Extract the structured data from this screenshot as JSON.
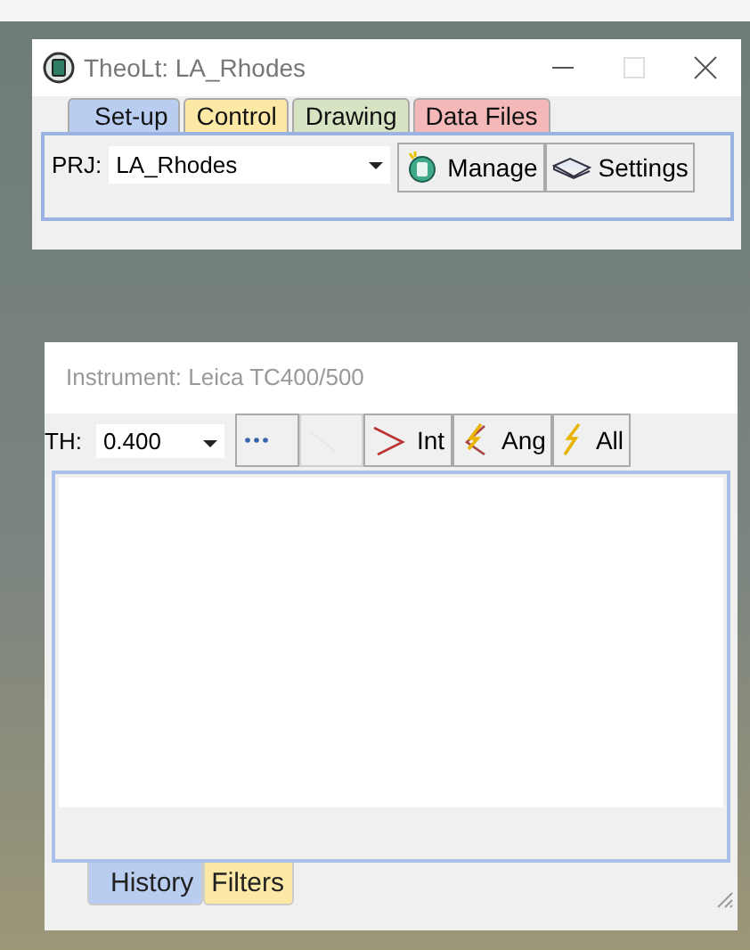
{
  "main_window": {
    "title": "TheoLt: LA_Rhodes",
    "tabs": [
      {
        "label": "Set-up",
        "selected": true,
        "color": "#b8cdf0"
      },
      {
        "label": "Control",
        "selected": false,
        "color": "#fde9a6"
      },
      {
        "label": "Drawing",
        "selected": false,
        "color": "#d7e4c4"
      },
      {
        "label": "Data Files",
        "selected": false,
        "color": "#f4b8b8"
      }
    ],
    "project_label": "PRJ:",
    "project_value": "LA_Rhodes",
    "buttons": [
      {
        "kind": "manage",
        "label": "Manage"
      },
      {
        "kind": "settings",
        "label": "Settings"
      }
    ]
  },
  "instrument_window": {
    "title": "Instrument: Leica TC400/500",
    "th_label": "TH:",
    "th_value": "0.400",
    "tools": [
      {
        "kind": "dots",
        "disabled": false
      },
      {
        "kind": "blank",
        "disabled": true
      },
      {
        "kind": "angle",
        "label": "Int",
        "disabled": false
      },
      {
        "kind": "bolt-angle",
        "label": "Ang",
        "disabled": false
      },
      {
        "kind": "bolt",
        "label": "All",
        "disabled": false
      }
    ],
    "tabs": [
      {
        "label": "History",
        "selected": true,
        "color": "#b8cdf0"
      },
      {
        "label": "Filters",
        "selected": false,
        "color": "#fde9a6"
      }
    ]
  }
}
